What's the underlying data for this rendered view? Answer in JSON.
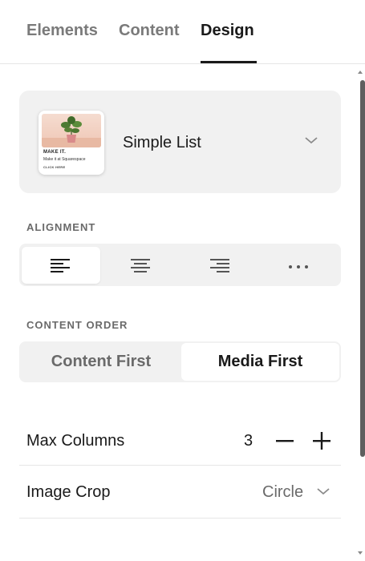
{
  "tabs": [
    {
      "label": "Elements"
    },
    {
      "label": "Content"
    },
    {
      "label": "Design"
    }
  ],
  "layout_selector": {
    "thumbnail": {
      "headline": "MAKE IT.",
      "subtext": "Make it at Squarespace",
      "cta": "CLICK HERE"
    },
    "name": "Simple List"
  },
  "alignment": {
    "label": "ALIGNMENT",
    "options": [
      {
        "icon": "align-left-icon",
        "selected": true
      },
      {
        "icon": "align-center-icon",
        "selected": false
      },
      {
        "icon": "align-right-icon",
        "selected": false
      },
      {
        "icon": "more-options-icon",
        "selected": false
      }
    ]
  },
  "content_order": {
    "label": "CONTENT ORDER",
    "options": [
      {
        "label": "Content First",
        "selected": false
      },
      {
        "label": "Media First",
        "selected": true
      }
    ]
  },
  "max_columns": {
    "label": "Max Columns",
    "value": "3"
  },
  "image_crop": {
    "label": "Image Crop",
    "value": "Circle"
  },
  "colors": {
    "accent": "#1a1a1a",
    "muted_text": "#6a6a6a",
    "panel_bg": "#f1f1f1"
  }
}
